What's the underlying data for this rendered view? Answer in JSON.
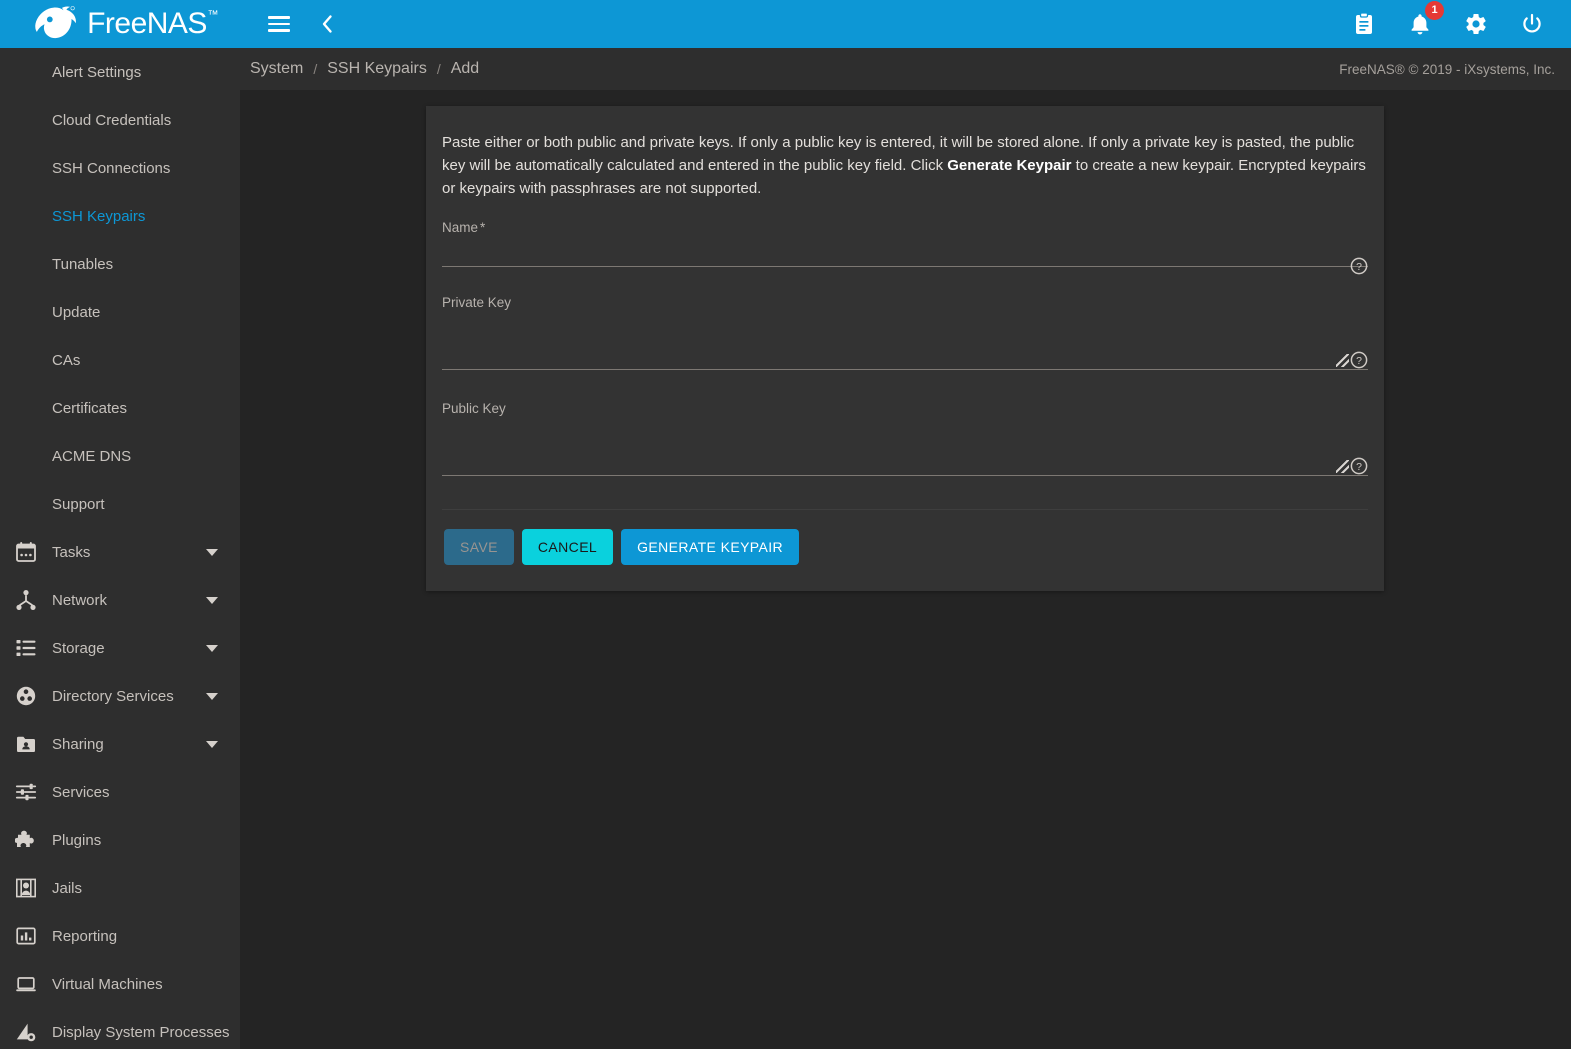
{
  "brand": {
    "name": "FreeNAS",
    "tm": "™"
  },
  "topbar": {
    "menu_icon": "hamburger-icon",
    "back_icon": "chevron-left-icon",
    "right_icons": [
      {
        "name": "clipboard-icon",
        "label": "Jobs"
      },
      {
        "name": "bell-icon",
        "label": "Alerts",
        "badge": "1"
      },
      {
        "name": "gear-icon",
        "label": "Settings"
      },
      {
        "name": "power-icon",
        "label": "Power"
      }
    ],
    "accent_color": "#0d97d5",
    "badge_color": "#e53935"
  },
  "breadcrumb": {
    "items": [
      "System",
      "SSH Keypairs",
      "Add"
    ],
    "separator": "/",
    "copyright": "FreeNAS® © 2019 - iXsystems, Inc."
  },
  "sidebar": {
    "items": [
      {
        "label": "Alert Settings",
        "icon": null,
        "sub": true,
        "active": false,
        "caret": false
      },
      {
        "label": "Cloud Credentials",
        "icon": null,
        "sub": true,
        "active": false,
        "caret": false
      },
      {
        "label": "SSH Connections",
        "icon": null,
        "sub": true,
        "active": false,
        "caret": false
      },
      {
        "label": "SSH Keypairs",
        "icon": null,
        "sub": true,
        "active": true,
        "caret": false
      },
      {
        "label": "Tunables",
        "icon": null,
        "sub": true,
        "active": false,
        "caret": false
      },
      {
        "label": "Update",
        "icon": null,
        "sub": true,
        "active": false,
        "caret": false
      },
      {
        "label": "CAs",
        "icon": null,
        "sub": true,
        "active": false,
        "caret": false
      },
      {
        "label": "Certificates",
        "icon": null,
        "sub": true,
        "active": false,
        "caret": false
      },
      {
        "label": "ACME DNS",
        "icon": null,
        "sub": true,
        "active": false,
        "caret": false
      },
      {
        "label": "Support",
        "icon": null,
        "sub": true,
        "active": false,
        "caret": false
      },
      {
        "label": "Tasks",
        "icon": "calendar-icon",
        "sub": false,
        "active": false,
        "caret": true
      },
      {
        "label": "Network",
        "icon": "network-share-icon",
        "sub": false,
        "active": false,
        "caret": true
      },
      {
        "label": "Storage",
        "icon": "storage-list-icon",
        "sub": false,
        "active": false,
        "caret": true
      },
      {
        "label": "Directory Services",
        "icon": "directory-services-icon",
        "sub": false,
        "active": false,
        "caret": true
      },
      {
        "label": "Sharing",
        "icon": "folder-shared-icon",
        "sub": false,
        "active": false,
        "caret": true
      },
      {
        "label": "Services",
        "icon": "tune-sliders-icon",
        "sub": false,
        "active": false,
        "caret": false
      },
      {
        "label": "Plugins",
        "icon": "puzzle-piece-icon",
        "sub": false,
        "active": false,
        "caret": false
      },
      {
        "label": "Jails",
        "icon": "jails-icon",
        "sub": false,
        "active": false,
        "caret": false
      },
      {
        "label": "Reporting",
        "icon": "bar-chart-icon",
        "sub": false,
        "active": false,
        "caret": false
      },
      {
        "label": "Virtual Machines",
        "icon": "laptop-icon",
        "sub": false,
        "active": false,
        "caret": false
      },
      {
        "label": "Display System Processes",
        "icon": "processes-icon",
        "sub": false,
        "active": false,
        "caret": false
      }
    ],
    "active_color": "#0d97d5"
  },
  "form": {
    "description_part1": "Paste either or both public and private keys. If only a public key is entered, it will be stored alone. If only a private key is pasted, the public key will be automatically calculated and entered in the public key field. Click ",
    "description_bold": "Generate Keypair",
    "description_part2": " to create a new keypair. Encrypted keypairs or keypairs with passphrases are not supported.",
    "fields": [
      {
        "label": "Name",
        "required": "*",
        "value": "",
        "placeholder": "",
        "help_icon": "help-circle-icon"
      },
      {
        "label": "Private Key",
        "required": "",
        "value": "",
        "placeholder": "",
        "help_icon": "help-circle-icon",
        "grip": "resize-grip-icon"
      },
      {
        "label": "Public Key",
        "required": "",
        "value": "",
        "placeholder": "",
        "help_icon": "help-circle-icon",
        "grip": "resize-grip-icon"
      }
    ],
    "buttons": {
      "save": "SAVE",
      "cancel": "CANCEL",
      "generate": "GENERATE KEYPAIR"
    },
    "button_colors": {
      "save_bg": "#2c6a8b",
      "cancel_bg": "#0ad1dd",
      "generate_bg": "#0d97d5"
    }
  }
}
